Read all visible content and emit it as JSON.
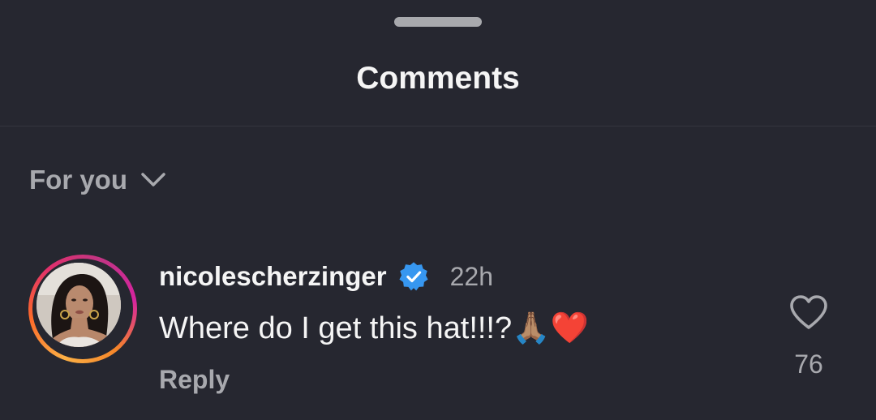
{
  "sheet": {
    "title": "Comments"
  },
  "sort": {
    "label": "For you"
  },
  "comment": {
    "username": "nicolescherzinger",
    "verified": true,
    "timestamp": "22h",
    "text": "Where do I get this hat!!!?🙏🏽❤️",
    "reply_label": "Reply",
    "like_count": "76"
  },
  "colors": {
    "background": "#262730",
    "verified_badge": "#3797f0",
    "secondary_text": "#a8a9ae"
  },
  "icons": {
    "verified": "verified-badge-icon",
    "like": "heart-outline-icon",
    "sort": "chevron-down-icon"
  }
}
